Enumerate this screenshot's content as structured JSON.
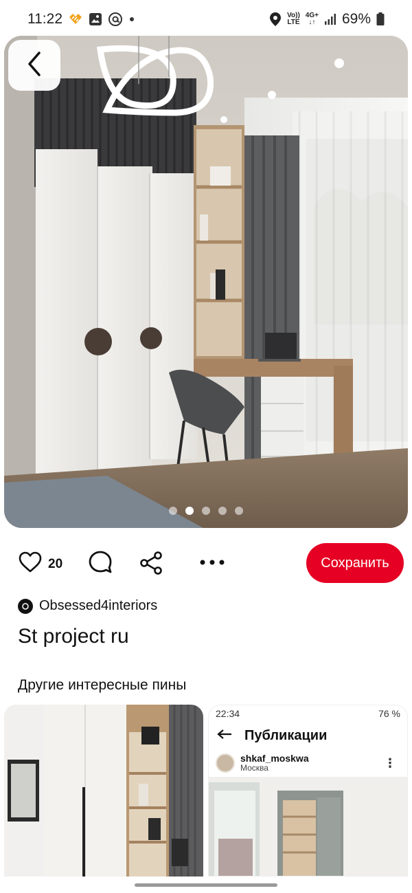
{
  "status_bar": {
    "time": "11:22",
    "lte_top": "Vo))",
    "lte_bottom": "LTE",
    "net_top": "4G+",
    "net_bottom": "↓↑",
    "battery": "69%"
  },
  "pin": {
    "like_count": "20",
    "save_label": "Сохранить",
    "author": "Obsessed4interiors",
    "title": "St project ru",
    "carousel": {
      "count": 5,
      "active_index": 1
    }
  },
  "more_pins": {
    "heading": "Другие интересные пины",
    "right_thumb": {
      "time": "22:34",
      "battery": "76 %",
      "header": "Публикации",
      "username": "shkaf_moskwa",
      "location": "Москва"
    }
  },
  "colors": {
    "accent": "#e60023",
    "text": "#111111"
  },
  "icons": {
    "back": "chevron-left-icon",
    "like": "heart-icon",
    "comment": "comment-icon",
    "share": "share-icon",
    "more": "more-dots-icon"
  }
}
